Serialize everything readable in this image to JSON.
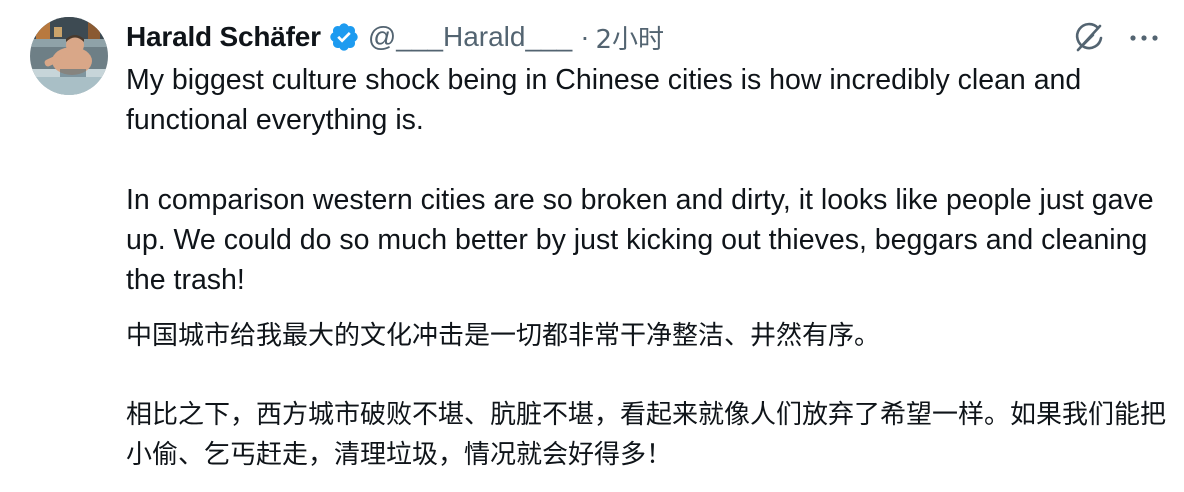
{
  "tweet": {
    "author": {
      "display_name": "Harald Schäfer",
      "handle": "@___Harald___",
      "verified": true,
      "avatar_icon": "avatar-photo"
    },
    "separator": "·",
    "timestamp": "2小时",
    "actions": {
      "grok_icon": "grok-icon",
      "more_icon": "more-options-icon"
    },
    "paragraphs": [
      "My biggest culture shock being in Chinese cities is how incredibly clean and functional everything is.",
      "In comparison western cities are so broken and dirty, it looks like people just gave up. We could do so much better by just kicking out thieves, beggars and cleaning the trash!",
      "中国城市给我最大的文化冲击是一切都非常干净整洁、井然有序。",
      "相比之下，西方城市破败不堪、肮脏不堪，看起来就像人们放弃了希望一样。如果我们能把小偷、乞丐赶走，清理垃圾，情况就会好得多！"
    ]
  },
  "colors": {
    "text_primary": "#0f1419",
    "text_secondary": "#536471",
    "verified_blue": "#1d9bf0",
    "background": "#ffffff"
  }
}
